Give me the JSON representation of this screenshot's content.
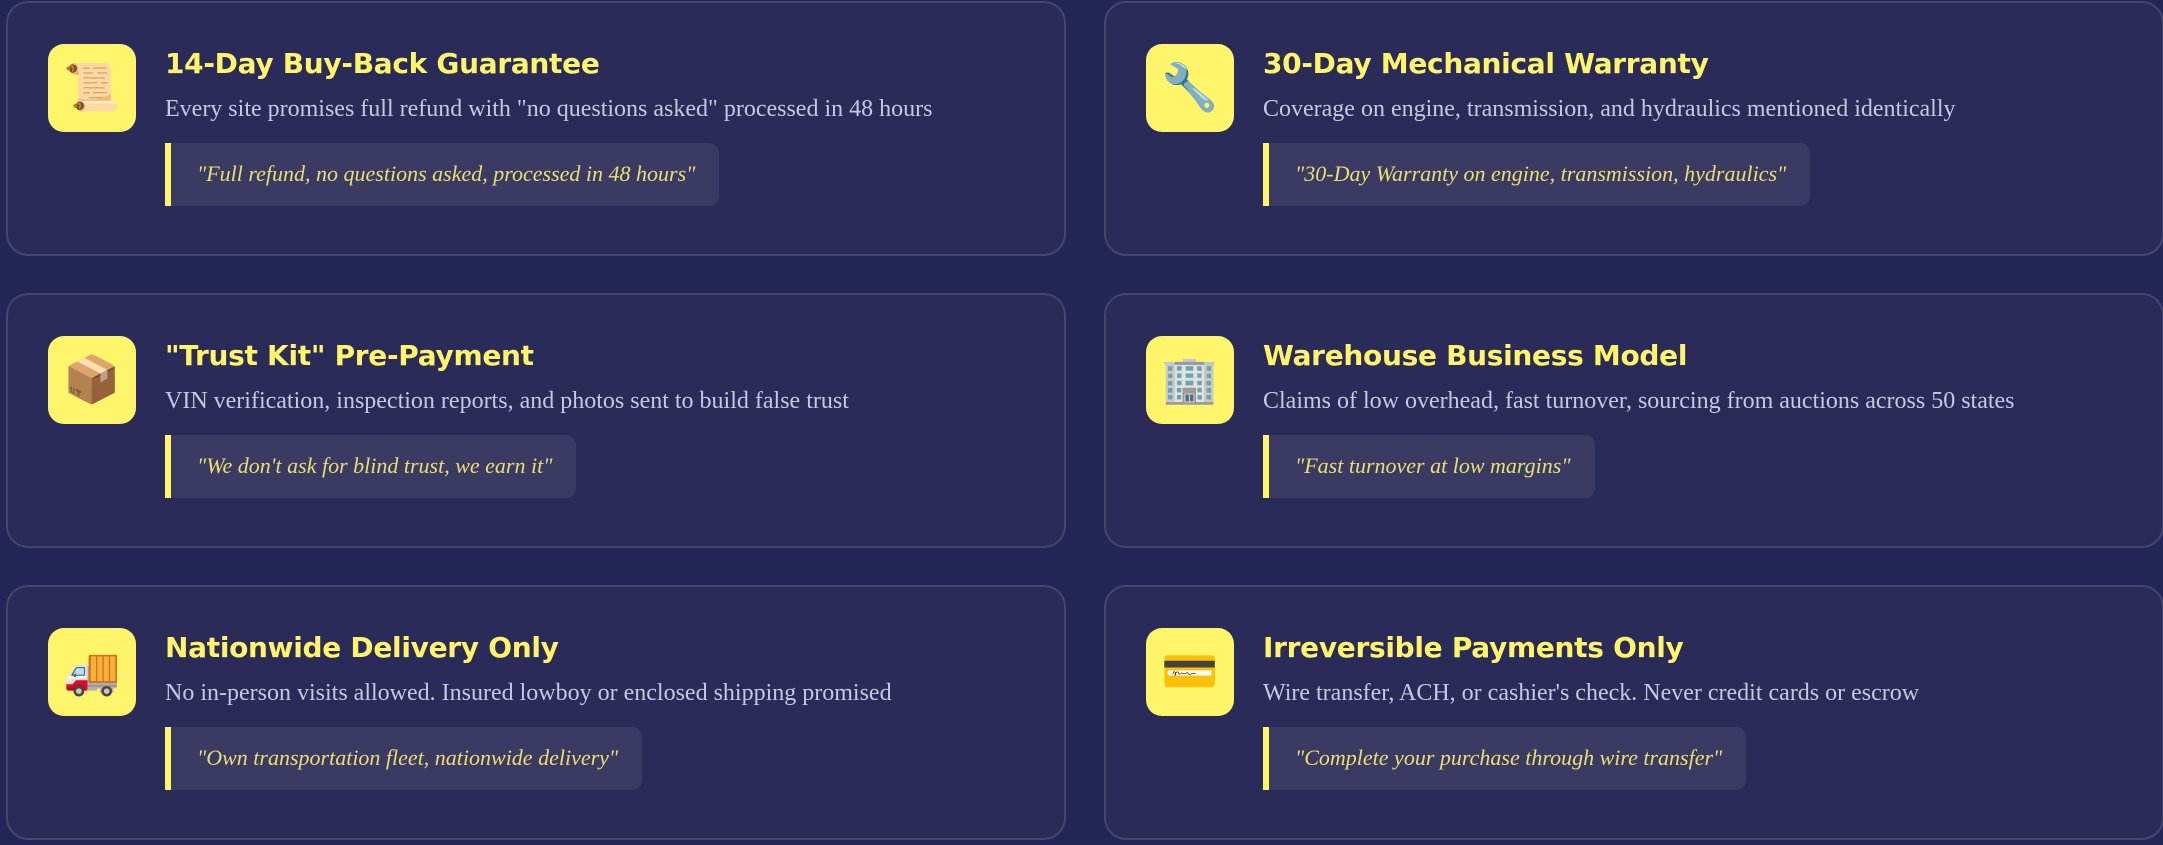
{
  "cards": [
    {
      "icon": "📜",
      "icon_name": "scroll-icon",
      "title": "14-Day Buy-Back Guarantee",
      "description": "Every site promises full refund with \"no questions asked\" processed in 48 hours",
      "quote": "\"Full refund, no questions asked, processed in 48 hours\""
    },
    {
      "icon": "🔧",
      "icon_name": "wrench-icon",
      "title": "30-Day Mechanical Warranty",
      "description": "Coverage on engine, transmission, and hydraulics mentioned identically",
      "quote": "\"30-Day Warranty on engine, transmission, hydraulics\""
    },
    {
      "icon": "📦",
      "icon_name": "package-icon",
      "title": "\"Trust Kit\" Pre-Payment",
      "description": "VIN verification, inspection reports, and photos sent to build false trust",
      "quote": "\"We don't ask for blind trust, we earn it\""
    },
    {
      "icon": "🏢",
      "icon_name": "office-building-icon",
      "title": "Warehouse Business Model",
      "description": "Claims of low overhead, fast turnover, sourcing from auctions across 50 states",
      "quote": "\"Fast turnover at low margins\""
    },
    {
      "icon": "🚚",
      "icon_name": "delivery-truck-icon",
      "title": "Nationwide Delivery Only",
      "description": "No in-person visits allowed. Insured lowboy or enclosed shipping promised",
      "quote": "\"Own transportation fleet, nationwide delivery\""
    },
    {
      "icon": "💳",
      "icon_name": "credit-card-icon",
      "title": "Irreversible Payments Only",
      "description": "Wire transfer, ACH, or cashier's check. Never credit cards or escrow",
      "quote": "\"Complete your purchase through wire transfer\""
    }
  ],
  "colors": {
    "background": "#242657",
    "card": "#2b2b59",
    "accent": "#fff56b",
    "text": "#c7c8df",
    "quote_text": "#e9df72"
  }
}
